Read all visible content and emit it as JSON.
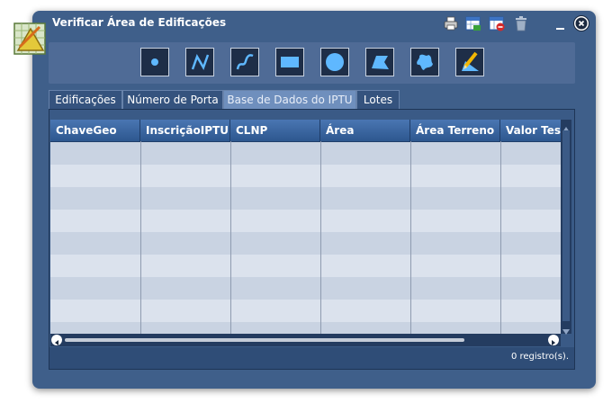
{
  "window": {
    "title": "Verificar Área de Edificações",
    "header_icons": [
      "printer-icon",
      "export-table-icon",
      "clear-table-icon",
      "trash-icon"
    ],
    "controls": [
      "minimize-icon",
      "close-icon"
    ]
  },
  "toolbar": {
    "tools": [
      "point-tool-icon",
      "polyline-tool-icon",
      "freehand-line-tool-icon",
      "rectangle-tool-icon",
      "circle-tool-icon",
      "polygon-tool-icon",
      "freehand-polygon-tool-icon",
      "edit-tool-icon"
    ]
  },
  "tabs": [
    {
      "label": "Edificações",
      "active": false
    },
    {
      "label": "Número de Porta",
      "active": false
    },
    {
      "label": "Base de Dados do IPTU",
      "active": true
    },
    {
      "label": "Lotes",
      "active": false
    }
  ],
  "grid": {
    "columns": [
      "ChaveGeo",
      "InscriçãoIPTU",
      "CLNP",
      "Área",
      "Área Terreno",
      "Valor Test"
    ],
    "rows": []
  },
  "footer": {
    "record_count": "0 registro(s)."
  },
  "colors": {
    "window_bg": "#3f5f8a",
    "header_bg": "#2d578f",
    "row_alt": "#c9d3e2",
    "row": "#dbe2ed"
  }
}
